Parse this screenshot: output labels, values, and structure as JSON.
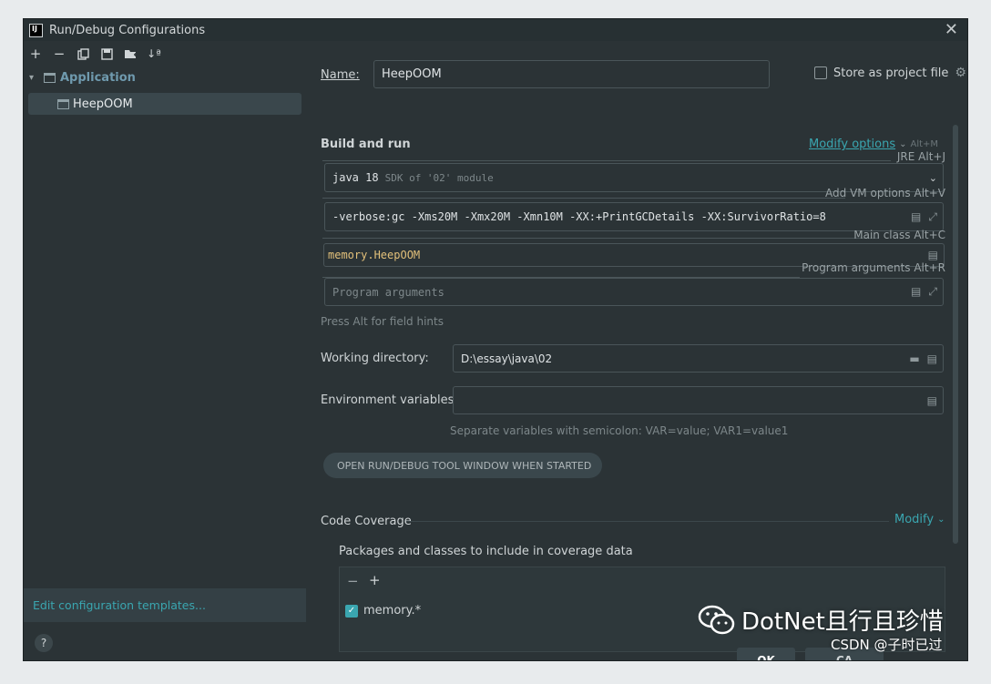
{
  "window": {
    "title": "Run/Debug Configurations"
  },
  "toolbar": {
    "icons": [
      "add-icon",
      "remove-icon",
      "copy-icon",
      "save-icon",
      "folder-add-icon",
      "sort-icon"
    ]
  },
  "tree": {
    "group_label": "Application",
    "selected_item": "HeepOOM"
  },
  "left_footer": {
    "edit_templates": "Edit configuration templates...",
    "help": "?"
  },
  "config": {
    "name_label": "Name:",
    "name_value": "HeepOOM",
    "store_label": "Store as project file",
    "build_run_title": "Build and run",
    "modify_options": "Modify options",
    "modify_options_hint": "Alt+M",
    "jre_hint": "JRE Alt+J",
    "jre_value": "java 18",
    "jre_sub": "SDK of '02' module",
    "vm_hint": "Add VM options Alt+V",
    "vm_value": "-verbose:gc -Xms20M -Xmx20M -Xmn10M -XX:+PrintGCDetails -XX:SurvivorRatio=8",
    "main_class_hint": "Main class Alt+C",
    "main_class_value": "memory.HeepOOM",
    "program_args_hint": "Program arguments Alt+R",
    "program_args_placeholder": "Program arguments",
    "field_hints_text": "Press Alt for field hints",
    "working_dir_label": "Working directory:",
    "working_dir_value": "D:\\essay\\java\\02",
    "env_label": "Environment variables:",
    "env_value": "",
    "env_help": "Separate variables with semicolon: VAR=value; VAR1=value1",
    "open_tool_window": "OPEN RUN/DEBUG TOOL WINDOW WHEN STARTED",
    "code_coverage_title": "Code Coverage",
    "modify": "Modify",
    "coverage_packages_label": "Packages and classes to include in coverage data",
    "coverage_pattern": "memory.*"
  },
  "buttons": {
    "ok": "OK",
    "cancel": "CA"
  },
  "watermark": {
    "main": "DotNet且行且珍惜",
    "sub": "CSDN @子时已过"
  },
  "colors": {
    "accent": "#3aa6b0",
    "background": "#2b3336",
    "selected": "#3a474c"
  }
}
